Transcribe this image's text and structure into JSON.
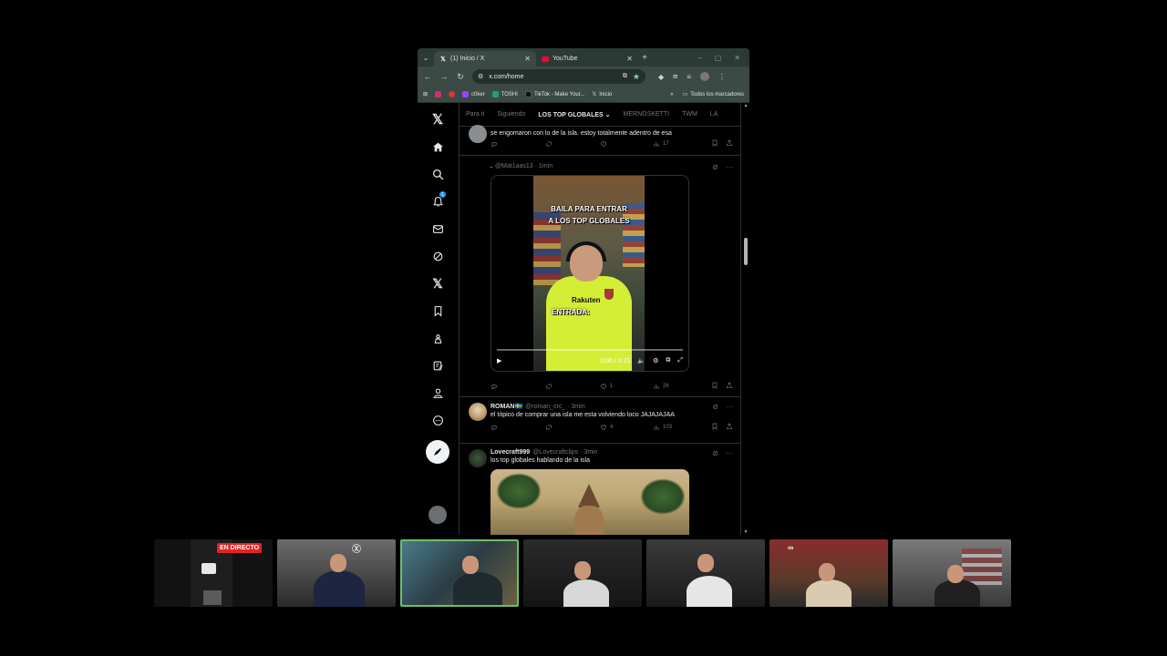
{
  "browser": {
    "tabs": [
      {
        "title": "(1) Inicio / X",
        "active": true
      },
      {
        "title": "YouTube",
        "active": false
      }
    ],
    "url": "x.com/home",
    "bookmarks": [
      "c0ker",
      "TOSHI",
      "TikTok - Make Your...",
      "Inicio"
    ],
    "bookmarks_all": "Todos los marcadores"
  },
  "x": {
    "notification_count": "1",
    "tabs": [
      "Para ti",
      "Siguiendo",
      "LOS TOP GLOBALES",
      "MERNOSKETTI",
      "TWM",
      "LA"
    ],
    "tweets": [
      {
        "text": "se engomaron con lo de la isla. estoy totalmente adentro de esa",
        "views": "17"
      },
      {
        "prefix": ".",
        "handle": "@Mat1aas13 · 1min",
        "video": {
          "caption1": "BAILA PARA ENTRAR",
          "caption2": "A LOS TOP GLOBALES",
          "caption3": "ENTRADA:",
          "sponsor": "Rakuten",
          "time": "0:00 / 0:21"
        },
        "likes": "1",
        "views": "26"
      },
      {
        "name": "ROMAN🇸🇪",
        "handle": "@roman_crc_ · 3min",
        "text": "el tópico de comprar una isla me esta volviendo loco JAJAJAJAA",
        "likes": "4",
        "views": "103"
      },
      {
        "name": "Lovecraft999",
        "handle": "@Lovecraftclips · 3min",
        "text": "los top globales hablando de la isla"
      }
    ]
  },
  "stream": {
    "live_label": "EN DIRECTO"
  },
  "colors": {
    "accent": "#1d9bf0",
    "browser_chrome": "#3b4a44",
    "live": "#e02424",
    "selected_cam": "#6bbf6b"
  }
}
